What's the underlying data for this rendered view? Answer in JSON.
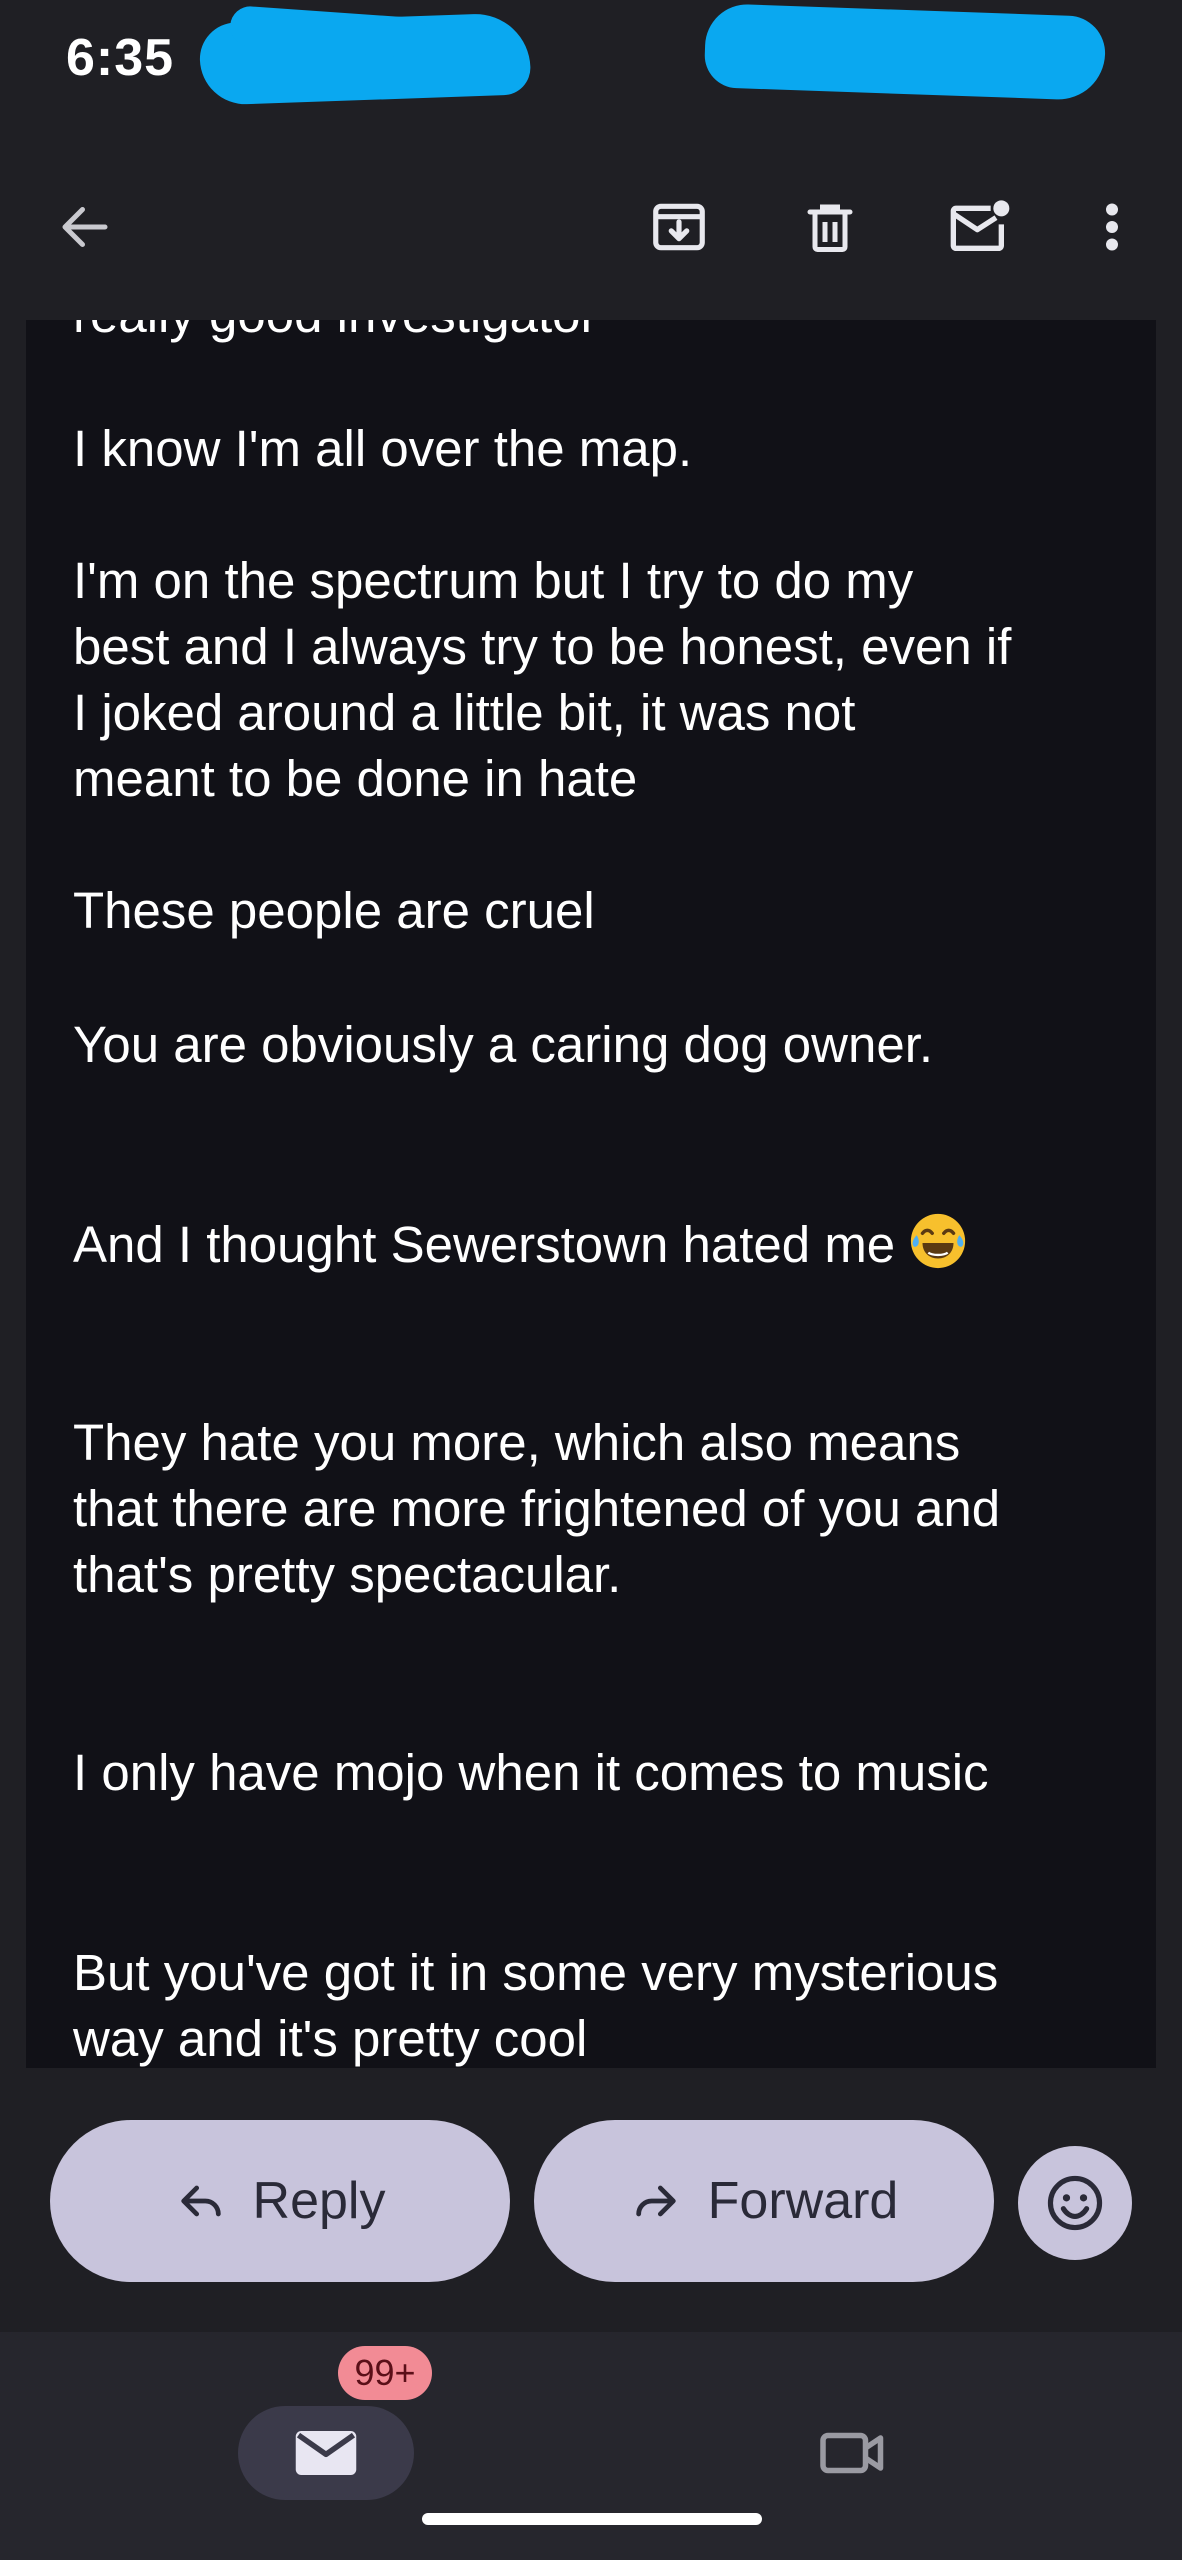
{
  "status_bar": {
    "time": "6:35"
  },
  "toolbar": {
    "back_icon": "arrow-back-icon",
    "archive_icon": "archive-icon",
    "delete_icon": "trash-icon",
    "mark_unread_icon": "mark-unread-icon",
    "more_icon": "more-vertical-icon"
  },
  "email": {
    "lines": [
      "really good investigator",
      "I know I'm all over the map.",
      "I'm on the spectrum but I try to do my",
      "best and I always try to be honest, even if",
      "I joked around a little bit, it was not",
      "meant to be done in hate",
      "These people are cruel",
      "You are obviously a caring dog owner.",
      "And I thought Sewerstown hated me",
      "They hate you more, which also means",
      "that there are more frightened of you and",
      "that's pretty spectacular.",
      "I only have mojo when it comes to music",
      "But you've got it in some very mysterious",
      "way and it's pretty cool"
    ]
  },
  "actions": {
    "reply_label": "Reply",
    "forward_label": "Forward",
    "emoji_icon": "smiley-face-icon"
  },
  "bottom_nav": {
    "mail_badge": "99+",
    "mail_icon": "mail-icon",
    "meet_icon": "video-camera-icon"
  },
  "colors": {
    "background": "#1f1f24",
    "email_body": "#111117",
    "button": "#c8c4dc",
    "badge": "#f28b95",
    "redaction": "#0aa8f0"
  }
}
